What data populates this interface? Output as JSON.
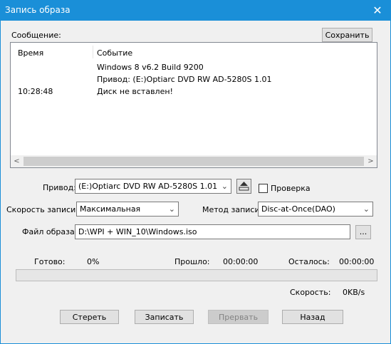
{
  "window": {
    "title": "Запись образа",
    "close_glyph": "✕"
  },
  "log": {
    "label": "Сообщение:",
    "save_button": "Сохранить",
    "headers": {
      "time": "Время",
      "event": "Событие"
    },
    "rows": [
      {
        "time": "",
        "event": "Windows 8 v6.2 Build 9200"
      },
      {
        "time": "",
        "event": "Привод: (E:)Optiarc DVD RW AD-5280S 1.01"
      },
      {
        "time": "10:28:48",
        "event": "Диск не вставлен!"
      }
    ]
  },
  "drive": {
    "label": "Привод:",
    "value": "(E:)Optiarc DVD RW AD-5280S 1.01",
    "eject_icon": "eject-drive-icon",
    "verify_label": "Проверка",
    "verify_checked": false
  },
  "speed": {
    "label": "Скорость записи:",
    "value": "Максимальная"
  },
  "method": {
    "label": "Метод записи:",
    "value": "Disc-at-Once(DAO)"
  },
  "image_file": {
    "label": "Файл образа:",
    "value": "D:\\WPI + WIN_10\\Windows.iso",
    "browse_label": "..."
  },
  "status": {
    "ready_label": "Готово:",
    "ready_value": "0%",
    "elapsed_label": "Прошло:",
    "elapsed_value": "00:00:00",
    "remaining_label": "Осталось:",
    "remaining_value": "00:00:00",
    "speed_label": "Скорость:",
    "speed_value": "0KB/s",
    "progress": 0
  },
  "buttons": {
    "erase": "Стереть",
    "write": "Записать",
    "abort": "Прервать",
    "back": "Назад"
  },
  "colors": {
    "titlebar": "#1a8fd8",
    "progress_fill": "#06b025"
  }
}
